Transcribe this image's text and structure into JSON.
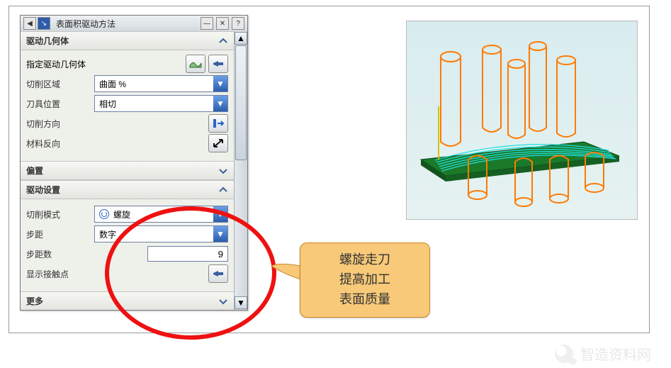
{
  "title": "表面积驱动方法",
  "sections": {
    "drive_geom": {
      "heading": "驱动几何体",
      "specify_label": "指定驱动几何体",
      "cut_area_label": "切削区域",
      "cut_area_value": "曲面 %",
      "tool_pos_label": "刀具位置",
      "tool_pos_value": "相切",
      "cut_dir_label": "切削方向",
      "mat_rev_label": "材料反向"
    },
    "offset": {
      "heading": "偏置"
    },
    "drive_set": {
      "heading": "驱动设置",
      "cut_mode_label": "切削模式",
      "cut_mode_value": "螺旋",
      "step_label": "步距",
      "step_value": "数字",
      "step_count_label": "步距数",
      "step_count_value": "9",
      "show_contact_label": "显示接触点"
    },
    "more": {
      "heading": "更多"
    }
  },
  "callout": {
    "l1": "螺旋走刀",
    "l2": "提高加工",
    "l3": "表面质量"
  },
  "watermark": "智造资料网"
}
